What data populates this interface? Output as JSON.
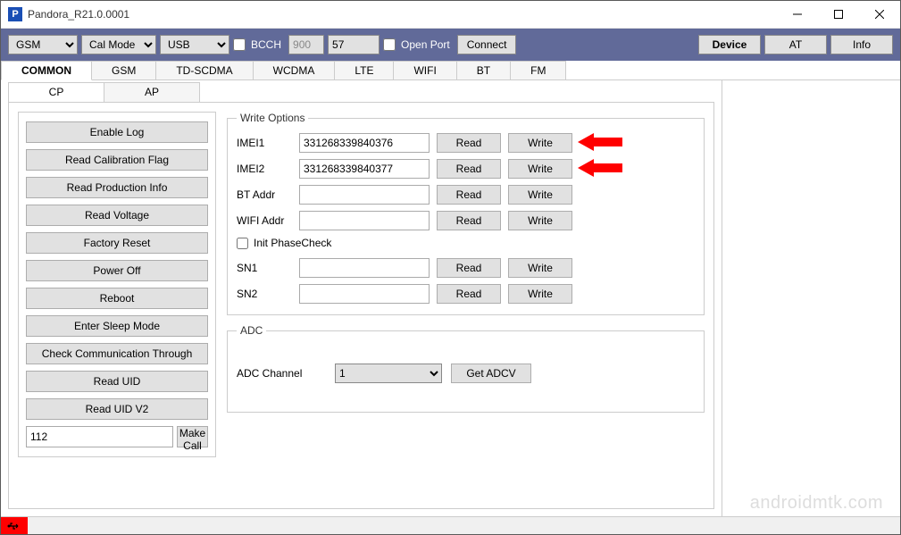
{
  "window": {
    "title": "Pandora_R21.0.0001"
  },
  "toolbar": {
    "mode1": "GSM",
    "mode2": "Cal Mode",
    "conn": "USB",
    "bcch_label": "BCCH",
    "bcch_val1": "900",
    "bcch_val2": "57",
    "openport_label": "Open Port",
    "connect": "Connect",
    "device": "Device",
    "at": "AT",
    "info": "Info"
  },
  "maintabs": [
    "COMMON",
    "GSM",
    "TD-SCDMA",
    "WCDMA",
    "LTE",
    "WIFI",
    "BT",
    "FM"
  ],
  "subtabs": [
    "CP",
    "AP"
  ],
  "left_buttons": [
    "Enable Log",
    "Read Calibration Flag",
    "Read Production Info",
    "Read Voltage",
    "Factory Reset",
    "Power Off",
    "Reboot",
    "Enter Sleep Mode",
    "Check Communication Through",
    "Read UID",
    "Read UID V2"
  ],
  "call": {
    "number": "112",
    "make_call": "Make Call"
  },
  "write_options": {
    "legend": "Write Options",
    "rows": [
      {
        "label": "IMEI1",
        "value": "331268339840376",
        "read": "Read",
        "write": "Write"
      },
      {
        "label": "IMEI2",
        "value": "331268339840377",
        "read": "Read",
        "write": "Write"
      },
      {
        "label": "BT Addr",
        "value": "",
        "read": "Read",
        "write": "Write"
      },
      {
        "label": "WIFI Addr",
        "value": "",
        "read": "Read",
        "write": "Write"
      }
    ],
    "init_phasecheck": "Init PhaseCheck",
    "sn_rows": [
      {
        "label": "SN1",
        "value": "",
        "read": "Read",
        "write": "Write"
      },
      {
        "label": "SN2",
        "value": "",
        "read": "Read",
        "write": "Write"
      }
    ]
  },
  "adc": {
    "legend": "ADC",
    "channel_label": "ADC Channel",
    "channel_value": "1",
    "get_adcv": "Get ADCV"
  },
  "watermark": "androidmtk.com"
}
